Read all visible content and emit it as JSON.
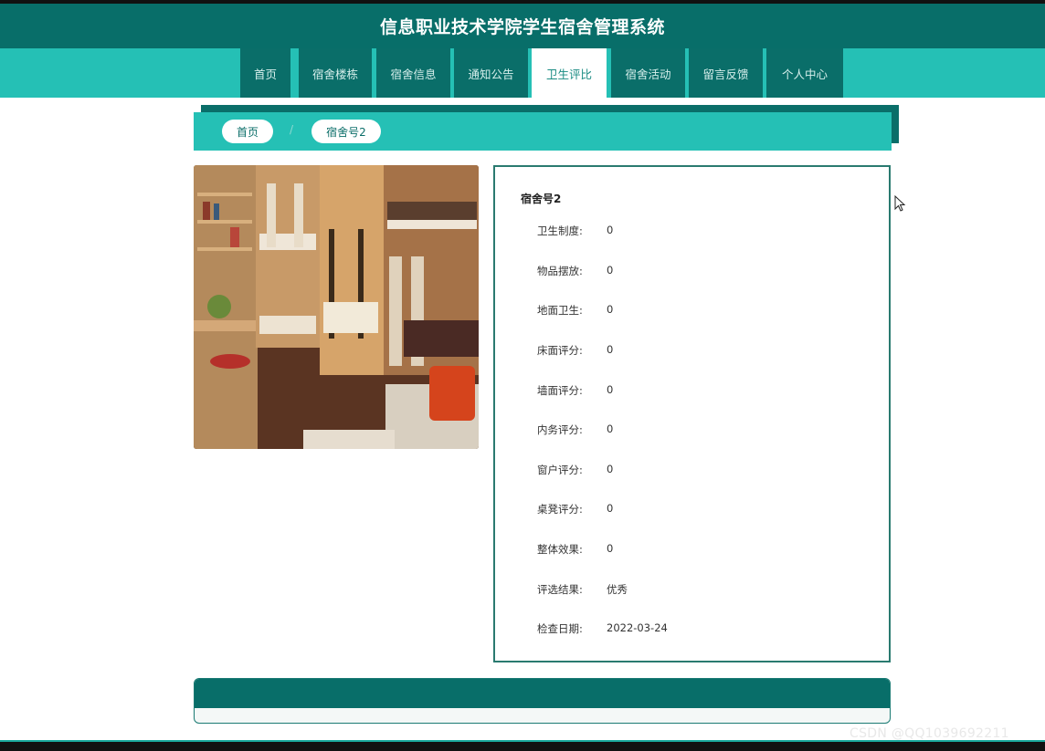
{
  "app": {
    "title": "信息职业技术学院学生宿舍管理系统"
  },
  "nav": {
    "items": [
      {
        "label": "首页",
        "active": false
      },
      {
        "label": "宿舍楼栋",
        "active": false
      },
      {
        "label": "宿舍信息",
        "active": false
      },
      {
        "label": "通知公告",
        "active": false
      },
      {
        "label": "卫生评比",
        "active": true
      },
      {
        "label": "宿舍活动",
        "active": false
      },
      {
        "label": "留言反馈",
        "active": false
      },
      {
        "label": "个人中心",
        "active": false
      }
    ]
  },
  "breadcrumb": {
    "home": "首页",
    "separator": "/",
    "current": "宿舍号2"
  },
  "detail": {
    "title": "宿舍号2",
    "fields": [
      {
        "label": "卫生制度:",
        "value": "0"
      },
      {
        "label": "物品摆放:",
        "value": "0"
      },
      {
        "label": "地面卫生:",
        "value": "0"
      },
      {
        "label": "床面评分:",
        "value": "0"
      },
      {
        "label": "墙面评分:",
        "value": "0"
      },
      {
        "label": "内务评分:",
        "value": "0"
      },
      {
        "label": "窗户评分:",
        "value": "0"
      },
      {
        "label": "桌凳评分:",
        "value": "0"
      },
      {
        "label": "整体效果:",
        "value": "0"
      },
      {
        "label": "评选结果:",
        "value": "优秀"
      },
      {
        "label": "检查日期:",
        "value": "2022-03-24"
      }
    ]
  },
  "watermark": "CSDN @QQ1039692211",
  "colors": {
    "header": "#086e69",
    "nav_bg": "#25c0b5",
    "nav_item": "#0a6e69",
    "active_tab": "#ffffff"
  }
}
